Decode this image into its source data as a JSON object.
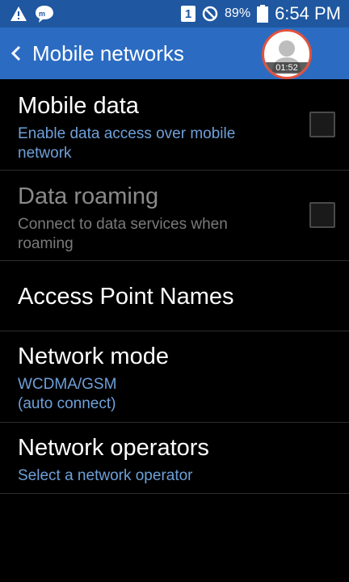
{
  "status_bar": {
    "sim_slot": "1",
    "battery_percent": "89%",
    "time": "6:54 PM"
  },
  "header": {
    "title": "Mobile networks"
  },
  "recording_overlay": {
    "time": "01:52"
  },
  "settings": [
    {
      "title": "Mobile data",
      "subtitle": "Enable data access over mobile network",
      "checked": false,
      "enabled": true
    },
    {
      "title": "Data roaming",
      "subtitle": "Connect to data services when roaming",
      "checked": false,
      "enabled": false
    },
    {
      "title": "Access Point Names"
    },
    {
      "title": "Network mode",
      "subtitle_line1": "WCDMA/GSM",
      "subtitle_line2": "(auto connect)"
    },
    {
      "title": "Network operators",
      "subtitle": "Select a network operator"
    }
  ],
  "colors": {
    "status_bar": "#1f57a0",
    "action_bar": "#2b6cc2",
    "accent_text": "#6ea0d9",
    "record_ring": "#e0523f"
  }
}
